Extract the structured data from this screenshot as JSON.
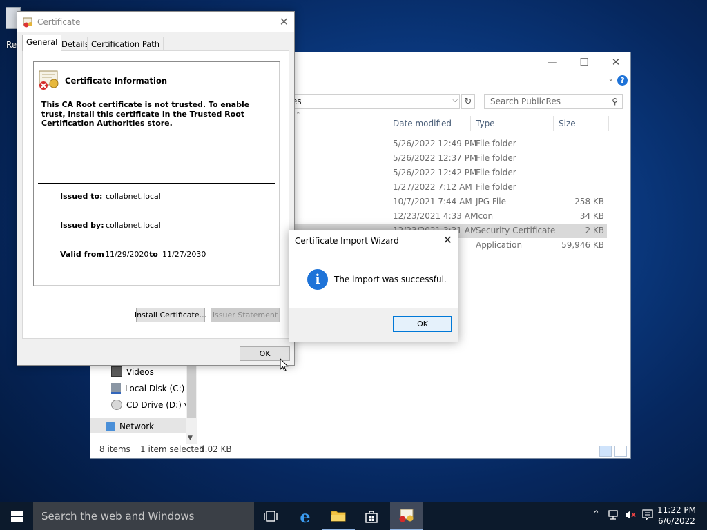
{
  "desktop": {
    "icon_label": "Re"
  },
  "explorer": {
    "controls": {
      "minimize": "—",
      "maximize": "☐",
      "close": "✕"
    },
    "help": "?",
    "address_text": "es",
    "search_placeholder": "Search PublicRes",
    "columns": {
      "date": "Date modified",
      "type": "Type",
      "size": "Size"
    },
    "rows": [
      {
        "date": "5/26/2022 12:49 PM",
        "type": "File folder",
        "size": ""
      },
      {
        "date": "5/26/2022 12:37 PM",
        "type": "File folder",
        "size": ""
      },
      {
        "date": "5/26/2022 12:42 PM",
        "type": "File folder",
        "size": ""
      },
      {
        "date": "1/27/2022 7:12 AM",
        "type": "File folder",
        "size": ""
      },
      {
        "date": "10/7/2021 7:44 AM",
        "type": "JPG File",
        "size": "258 KB"
      },
      {
        "date": "12/23/2021 4:33 AM",
        "type": "Icon",
        "size": "34 KB"
      },
      {
        "date": "12/23/2021 3:31 AM",
        "type": "Security Certificate",
        "size": "2 KB"
      },
      {
        "date": "",
        "type": "Application",
        "size": "59,946 KB"
      }
    ],
    "nav": {
      "videos": "Videos",
      "local_disk": "Local Disk (C:)",
      "cd_drive": "CD Drive (D:) virt",
      "network": "Network"
    },
    "status": {
      "items": "8 items",
      "selected": "1 item selected",
      "size": "1.02 KB"
    }
  },
  "certificate": {
    "title": "Certificate",
    "tabs": {
      "general": "General",
      "details": "Details",
      "path": "Certification Path"
    },
    "header": "Certificate Information",
    "warning": "This CA Root certificate is not trusted. To enable trust, install this certificate in the Trusted Root Certification Authorities store.",
    "issued_to_label": "Issued to:",
    "issued_to": "collabnet.local",
    "issued_by_label": "Issued by:",
    "issued_by": "collabnet.local",
    "valid_from_label": "Valid from",
    "valid_from": "11/29/2020",
    "to_label": "to",
    "valid_to": "11/27/2030",
    "install_button": "Install Certificate...",
    "issuer_button": "Issuer Statement",
    "ok_button": "OK"
  },
  "wizard": {
    "title": "Certificate Import Wizard",
    "message": "The import was successful.",
    "ok_button": "OK"
  },
  "taskbar": {
    "search_placeholder": "Search the web and Windows",
    "time": "11:22 PM",
    "date": "6/6/2022"
  }
}
